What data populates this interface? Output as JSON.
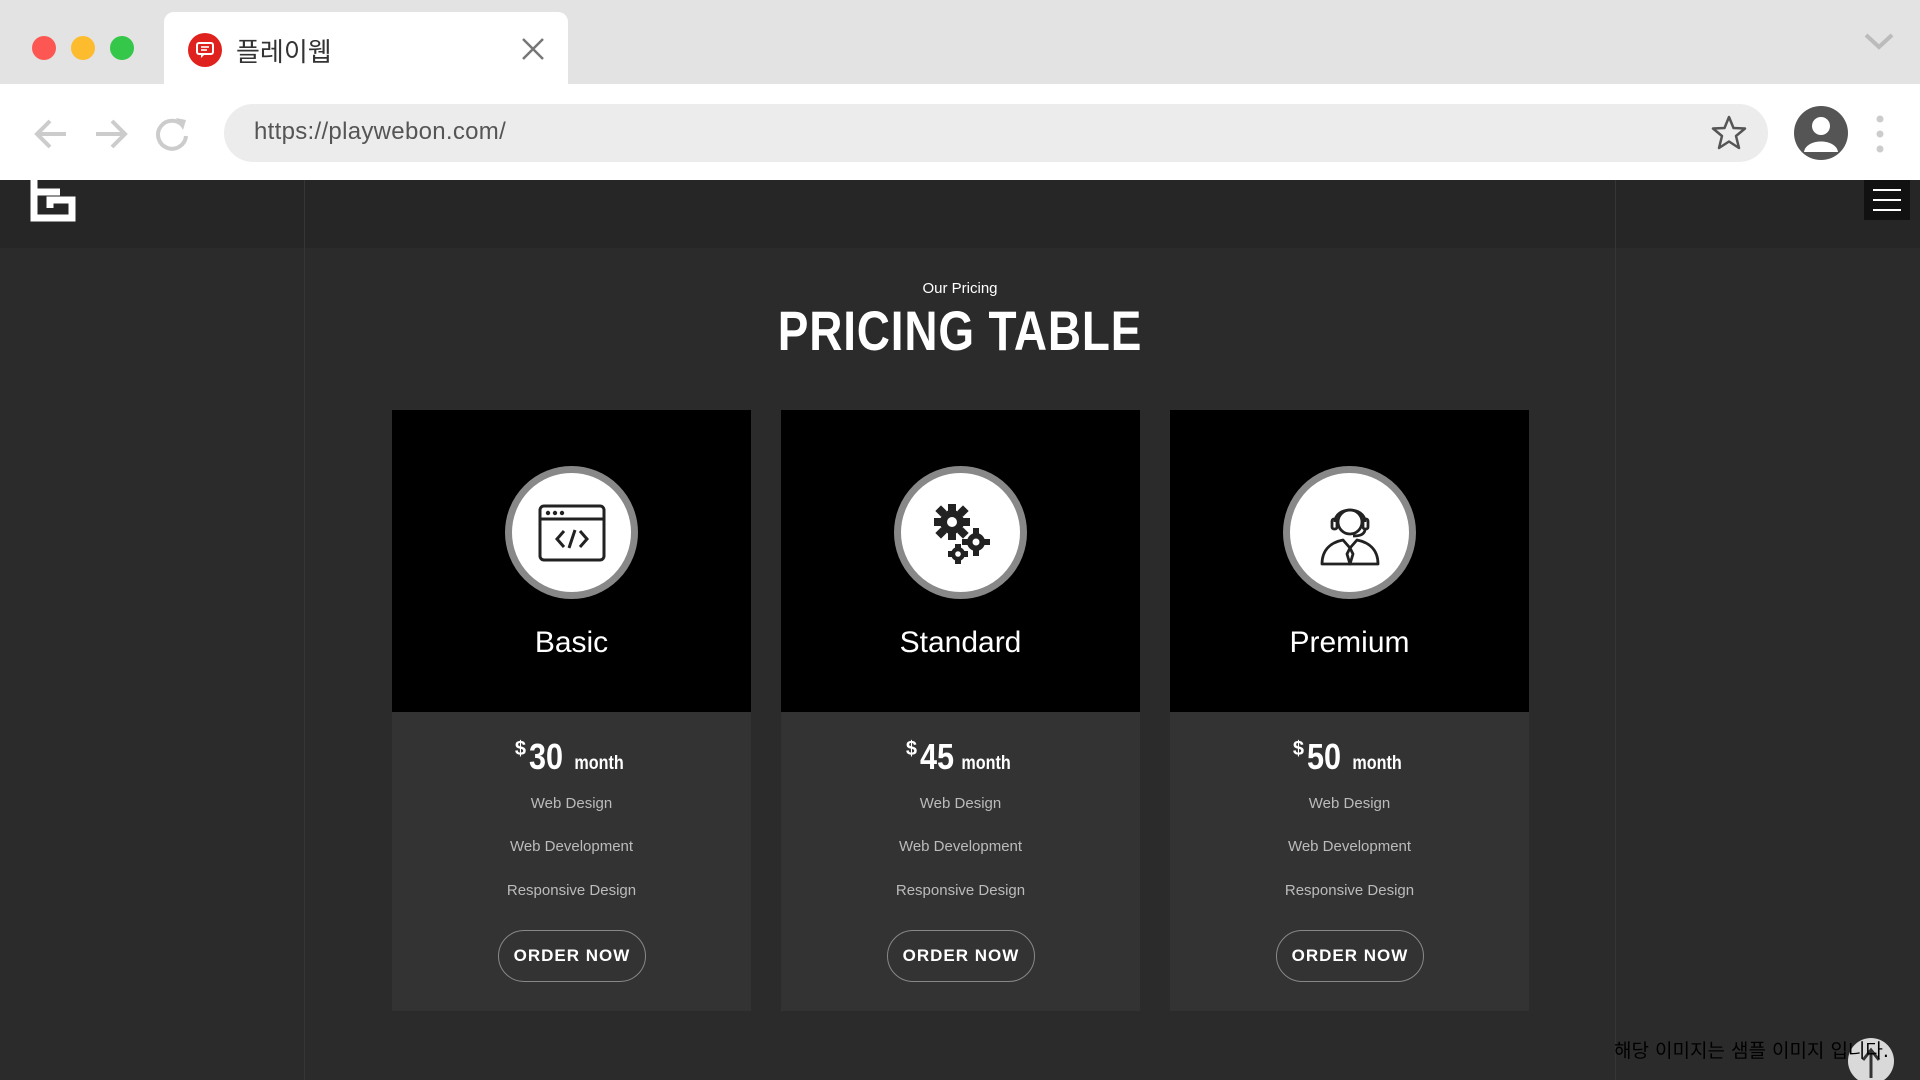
{
  "browser": {
    "tab_title": "플레이웹",
    "url": "https://playwebon.com/"
  },
  "section": {
    "eyebrow": "Our Pricing",
    "title": "PRICING TABLE"
  },
  "plans": [
    {
      "name": "Basic",
      "currency": "$",
      "price": "30",
      "period": "month",
      "icon": "code-window-icon",
      "features": [
        "Web Design",
        "Web Development",
        "Responsive Design"
      ],
      "button": "ORDER NOW"
    },
    {
      "name": "Standard",
      "currency": "$",
      "price": "45",
      "period": "month",
      "icon": "gears-icon",
      "features": [
        "Web Design",
        "Web Development",
        "Responsive Design"
      ],
      "button": "ORDER NOW"
    },
    {
      "name": "Premium",
      "currency": "$",
      "price": "50",
      "period": "month",
      "icon": "support-agent-icon",
      "features": [
        "Web Design",
        "Web Development",
        "Responsive Design"
      ],
      "button": "ORDER NOW"
    }
  ],
  "watermark": "해당 이미지는 샘플 이미지 입니다.",
  "colors": {
    "accent": "#e0221e",
    "page_bg": "#2b2b2b",
    "card_top": "#000000",
    "card_body": "#333333"
  }
}
